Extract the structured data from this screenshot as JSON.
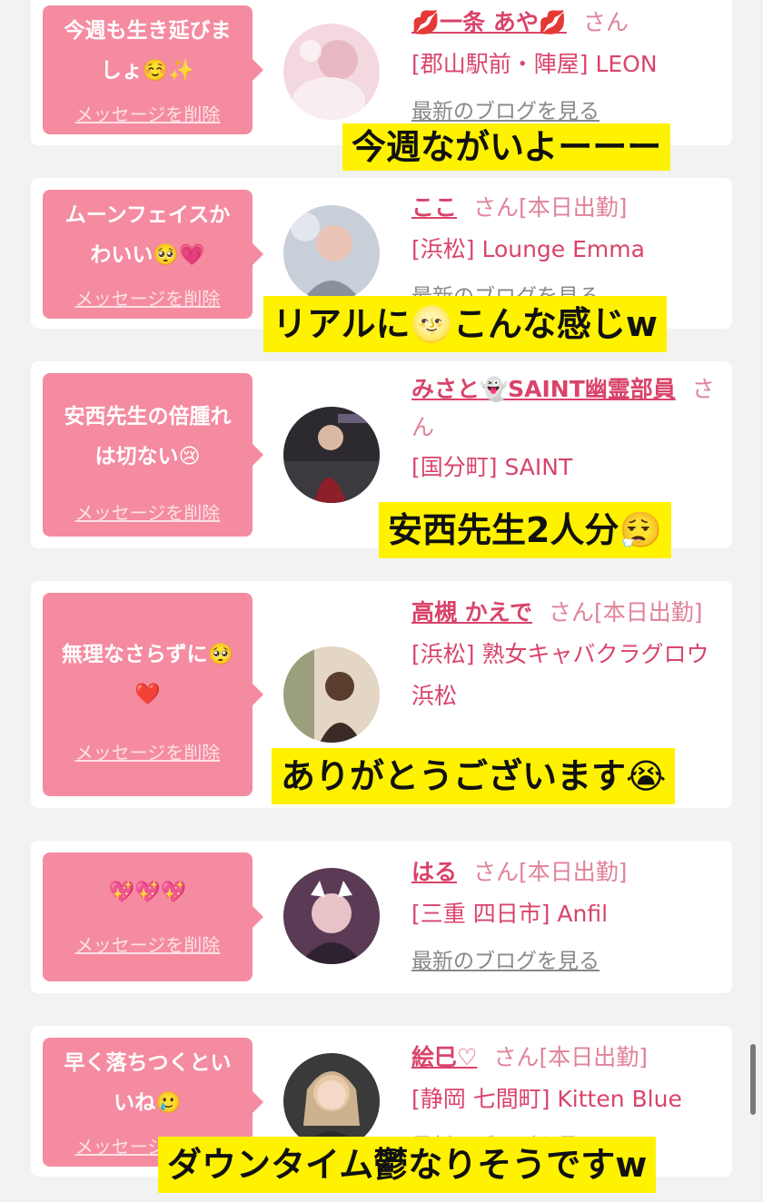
{
  "messages": [
    {
      "bubble_text": "今週も生き延びま\nしょ☺️✨",
      "delete_label": "メッセージを削除",
      "name": "💋一条 あや💋",
      "honorific": "さん",
      "status": "",
      "shop": "[郡山駅前・陣屋] LEON",
      "blog": "最新のブログを見る",
      "caption": "今週ながいよーーー"
    },
    {
      "bubble_text": "ムーンフェイスか\nわいい🥺💗",
      "delete_label": "メッセージを削除",
      "name": "ここ",
      "honorific": "さん",
      "status": "[本日出勤]",
      "shop": "[浜松] Lounge Emma",
      "blog": "最新のブログを見る",
      "caption": "リアルに🌝こんな感じw"
    },
    {
      "bubble_text": "安西先生の倍腫れ\nは切ない😢",
      "delete_label": "メッセージを削除",
      "name": "みさと👻SAINT幽霊部員",
      "honorific": "さん",
      "status": "",
      "shop": "[国分町] SAINT",
      "blog": "",
      "caption": "安西先生2人分😮‍💨"
    },
    {
      "bubble_text": "無理なさらずに🥺\n❤️",
      "delete_label": "メッセージを削除",
      "name": "高槻 かえで",
      "honorific": "さん",
      "status": "[本日出勤]",
      "shop": "[浜松] 熟女キャバクラグロウ 浜松",
      "blog": "",
      "caption": "ありがとうございます😭"
    },
    {
      "bubble_text": "💖💖💖",
      "delete_label": "メッセージを削除",
      "name": "はる",
      "honorific": "さん",
      "status": "[本日出勤]",
      "shop": "[三重 四日市] Anfil",
      "blog": "最新のブログを見る",
      "caption": ""
    },
    {
      "bubble_text": "早く落ちつくとい\nいね🥲",
      "delete_label": "メッセージを削除",
      "name": "絵巳♡",
      "honorific": "さん",
      "status": "[本日出勤]",
      "shop": "[静岡 七間町] Kitten Blue",
      "blog": "最新のブログを見る",
      "caption": "ダウンタイム鬱なりそうですw"
    }
  ],
  "colors": {
    "bubble": "#f58ba0",
    "accent": "#d9446a",
    "caption_bg": "#fff200"
  }
}
